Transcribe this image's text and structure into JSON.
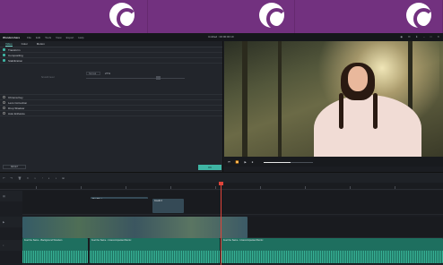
{
  "app": {
    "name": "Wondershare",
    "menu": [
      "File",
      "Edit",
      "Tools",
      "View",
      "Export",
      "Help"
    ],
    "doc_title": "Untitled : 00:00:00:19"
  },
  "left_panel": {
    "tabs": [
      "Video",
      "Color",
      "Motion"
    ],
    "sections": [
      {
        "label": "Transform",
        "checked": true
      },
      {
        "label": "Compositing",
        "checked": true
      },
      {
        "label": "Stabilization",
        "checked": true
      }
    ],
    "speed_field": "Normal",
    "speed_value": "27%",
    "slider_label": "Smooth level",
    "extra_sections": [
      {
        "label": "Chroma Key"
      },
      {
        "label": "Lens Correction"
      },
      {
        "label": "Drop Shadow"
      },
      {
        "label": "Auto Enhance"
      }
    ],
    "reset_label": "RESET",
    "ok_label": "OK"
  },
  "preview": {
    "playback_controls": [
      "⏮",
      "⏪",
      "▶",
      "⏹"
    ],
    "progress": 0.55
  },
  "timeline": {
    "toolbar_icons": [
      "undo-icon",
      "redo-icon",
      "delete-icon",
      "cut-icon",
      "crop-icon",
      "speed-icon",
      "color-icon",
      "audio-icon",
      "stabilize-icon"
    ],
    "clips": {
      "title_clip_1": "Pro Title / ...",
      "title_clip_2": "Credit 3",
      "audio_labels": [
        "Feel the Same - Background Wonders",
        "Feel the Same - Unaccompanied Remix",
        "Feel the Same - Unaccompanied Remix"
      ]
    }
  },
  "colors": {
    "accent": "#3fb5a4",
    "banner": "#72317f",
    "playhead": "#e0443a"
  }
}
